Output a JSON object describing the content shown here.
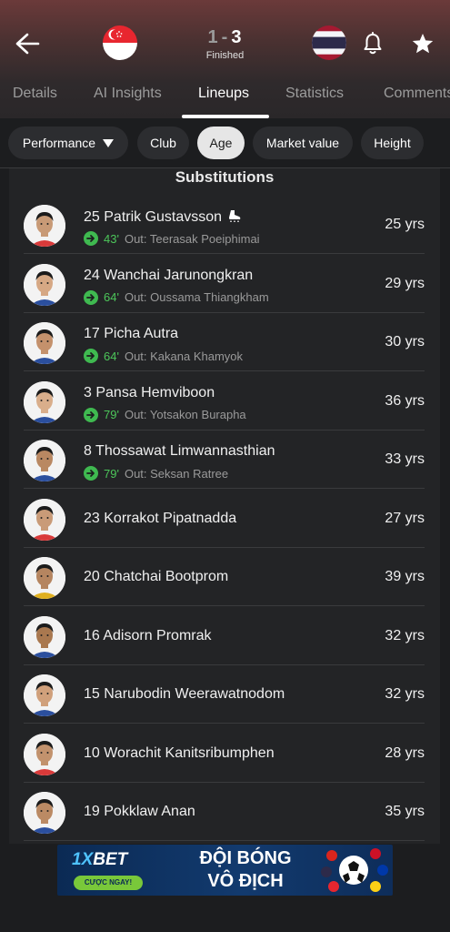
{
  "match": {
    "home_score": "1",
    "separator": "-",
    "away_score": "3",
    "status": "Finished"
  },
  "tabs": [
    "Details",
    "AI Insights",
    "Lineups",
    "Statistics",
    "Comments"
  ],
  "active_tab": "Lineups",
  "filters": {
    "dropdown_label": "Performance",
    "chips": [
      "Club",
      "Age",
      "Market value",
      "Height"
    ],
    "active_chip": "Age"
  },
  "section_title": "Substitutions",
  "players": [
    {
      "number": "25",
      "name": "Patrik Gustavsson",
      "label": "25 Patrik Gustavsson",
      "scored": true,
      "minute": "43'",
      "out": "Out: Teerasak Poeiphimai",
      "age": "25 yrs"
    },
    {
      "number": "24",
      "name": "Wanchai Jarunongkran",
      "label": "24 Wanchai Jarunongkran",
      "minute": "64'",
      "out": "Out: Oussama Thiangkham",
      "age": "29 yrs"
    },
    {
      "number": "17",
      "name": "Picha Autra",
      "label": "17 Picha Autra",
      "minute": "64'",
      "out": "Out: Kakana Khamyok",
      "age": "30 yrs"
    },
    {
      "number": "3",
      "name": "Pansa Hemviboon",
      "label": "3 Pansa Hemviboon",
      "minute": "79'",
      "out": "Out: Yotsakon Burapha",
      "age": "36 yrs"
    },
    {
      "number": "8",
      "name": "Thossawat Limwannasthian",
      "label": "8 Thossawat Limwannasthian",
      "minute": "79'",
      "out": "Out: Seksan Ratree",
      "age": "33 yrs"
    },
    {
      "number": "23",
      "name": "Korrakot Pipatnadda",
      "label": "23 Korrakot Pipatnadda",
      "age": "27 yrs"
    },
    {
      "number": "20",
      "name": "Chatchai Bootprom",
      "label": "20 Chatchai Bootprom",
      "age": "39 yrs"
    },
    {
      "number": "16",
      "name": "Adisorn Promrak",
      "label": "16 Adisorn Promrak",
      "age": "32 yrs"
    },
    {
      "number": "15",
      "name": "Narubodin Weerawatnodom",
      "label": "15 Narubodin Weerawatnodom",
      "age": "32 yrs"
    },
    {
      "number": "10",
      "name": "Worachit Kanitsribumphen",
      "label": "10 Worachit Kanitsribumphen",
      "age": "28 yrs"
    },
    {
      "number": "19",
      "name": "Pokklaw Anan",
      "label": "19 Pokklaw Anan",
      "age": "35 yrs"
    }
  ],
  "ad": {
    "brand_prefix": "1X",
    "brand_suffix": "BET",
    "cta": "CƯỢC NGAY!",
    "line1": "ĐỘI BÓNG",
    "line2": "VÔ ĐỊCH"
  },
  "icons": {
    "back": "back-arrow-icon",
    "home_flag": "singapore-flag-icon",
    "away_flag": "thailand-flag-icon",
    "notifications": "bell-icon",
    "favorite": "star-icon",
    "substitution": "substitution-arrow-icon",
    "goal": "football-boot-icon"
  },
  "colors": {
    "accent_green": "#4cc65a",
    "background": "#1c1d1f",
    "card": "#232426"
  }
}
